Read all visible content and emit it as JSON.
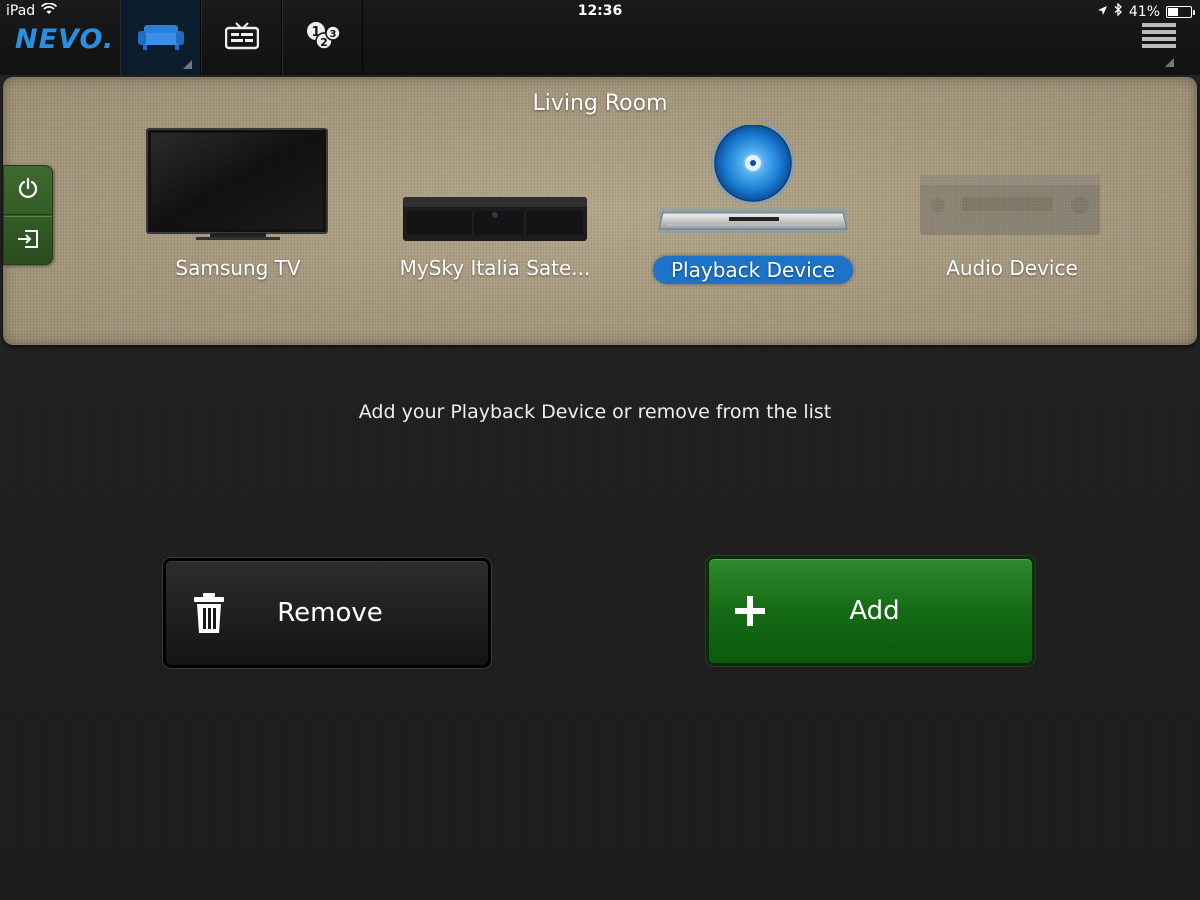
{
  "status_bar": {
    "device": "iPad",
    "time": "12:36",
    "battery": "41%",
    "battery_level": 0.41
  },
  "nav": {
    "logo": "NEVO.",
    "tabs": [
      {
        "name": "rooms-tab",
        "icon": "sofa-icon",
        "active": true
      },
      {
        "name": "guide-tab",
        "icon": "tv-guide-icon",
        "active": false
      },
      {
        "name": "favorites-tab",
        "icon": "numbers-icon",
        "active": false
      }
    ],
    "menu_icon": "hamburger-menu-icon"
  },
  "room": {
    "title": "Living Room",
    "controls": [
      "power-icon",
      "input-icon"
    ],
    "devices": [
      {
        "label": "Samsung TV",
        "icon": "tv-icon",
        "selected": false
      },
      {
        "label": "MySky Italia Sate...",
        "icon": "satellite-box-icon",
        "selected": false
      },
      {
        "label": "Playback Device",
        "icon": "disc-player-icon",
        "selected": true
      },
      {
        "label": "Audio Device",
        "icon": "audio-receiver-icon",
        "selected": false
      }
    ]
  },
  "main": {
    "hint": "Add your Playback Device or remove from the list",
    "remove_label": "Remove",
    "add_label": "Add"
  },
  "colors": {
    "accent_blue": "#1d73c8",
    "add_green": "#156b15",
    "panel_beige": "#a89a80"
  }
}
